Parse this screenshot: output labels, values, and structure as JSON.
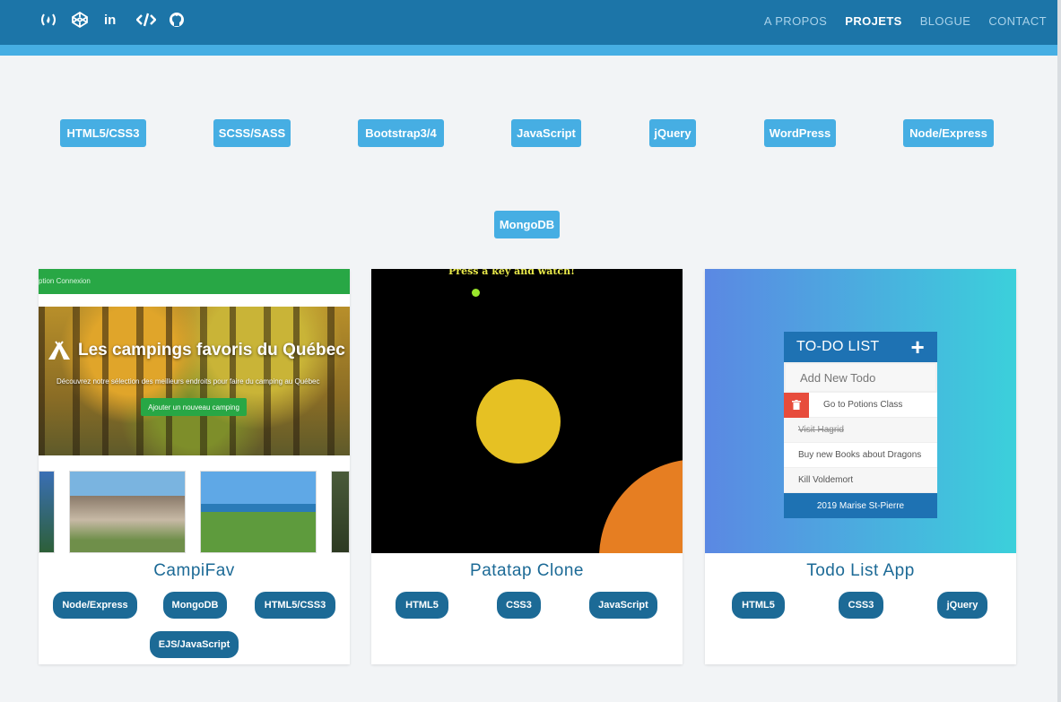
{
  "header": {
    "social_icons": [
      "freecodecamp-icon",
      "codepen-icon",
      "linkedin-icon",
      "code-icon",
      "github-icon"
    ],
    "linkedin_text": "in",
    "nav": [
      {
        "label": "A PROPOS",
        "active": false
      },
      {
        "label": "PROJETS",
        "active": true
      },
      {
        "label": "BLOGUE",
        "active": false
      },
      {
        "label": "CONTACT",
        "active": false
      }
    ]
  },
  "filters": [
    "HTML5/CSS3",
    "SCSS/SASS",
    "Bootstrap3/4",
    "JavaScript",
    "jQuery",
    "WordPress",
    "Node/Express",
    "MongoDB"
  ],
  "colors": {
    "header": "#1c75a8",
    "header_stripe": "#46aee3",
    "tag": "#46aee3",
    "pill": "#1c6a96"
  },
  "projects": [
    {
      "title": "CampiFav",
      "tags": [
        "Node/Express",
        "MongoDB",
        "HTML5/CSS3",
        "EJS/JavaScript"
      ],
      "thumb": {
        "nav_text": "ption   Connexion",
        "hero_title": "Les campings favoris du Québec",
        "hero_sub": "Découvrez notre sélection des meilleurs endroits pour faire du camping au Québec",
        "hero_button": "Ajouter un nouveau camping"
      }
    },
    {
      "title": "Patatap Clone",
      "tags": [
        "HTML5",
        "CSS3",
        "JavaScript"
      ],
      "thumb": {
        "text": "Press a key and watch!"
      }
    },
    {
      "title": "Todo List App",
      "tags": [
        "HTML5",
        "CSS3",
        "jQuery"
      ],
      "thumb": {
        "header": "TO-DO LIST",
        "plus": "+",
        "input_placeholder": "Add New Todo",
        "items": [
          "Go to Potions Class",
          "Visit Hagrid",
          "Buy new Books about Dragons",
          "Kill Voldemort"
        ],
        "footer": "2019 Marise St-Pierre"
      }
    }
  ]
}
